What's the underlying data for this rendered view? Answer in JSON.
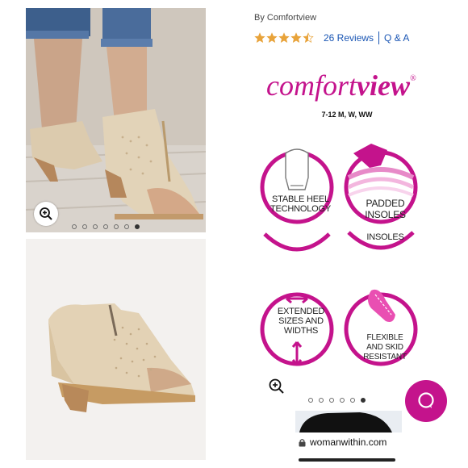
{
  "left": {
    "top_photo": {
      "dot_count": 7,
      "active_dot": 6,
      "zoom_icon": "zoom-in-icon"
    },
    "bottom_photo": {
      "description_icon": "sandal-image"
    }
  },
  "product": {
    "byline": "By Comfortview",
    "rating": {
      "stars": 4.5,
      "reviews_label": "26 Reviews",
      "qa_label": "Q & A"
    }
  },
  "brand": {
    "name_part1": "comfort",
    "name_part2": "view",
    "registered": "®",
    "sizes": "7-12 M, W, WW"
  },
  "features": {
    "stable_heel": [
      "STABLE HEEL",
      "TECHNOLOGY"
    ],
    "padded_insoles": [
      "PADDED",
      "INSOLES"
    ],
    "repeat_fragment": "INSOLES",
    "extended_sizes": [
      "EXTENDED",
      "SIZES AND",
      "WIDTHS"
    ],
    "flexible": [
      "FLEXIBLE",
      "AND SKID",
      "RESISTANT"
    ]
  },
  "carousel": {
    "dot_count": 6,
    "active_dot": 5
  },
  "browser": {
    "url": "womanwithin.com"
  },
  "colors": {
    "brand_magenta": "#c4138c",
    "link_blue": "#1a56b4",
    "star_gold": "#e8a33a"
  }
}
